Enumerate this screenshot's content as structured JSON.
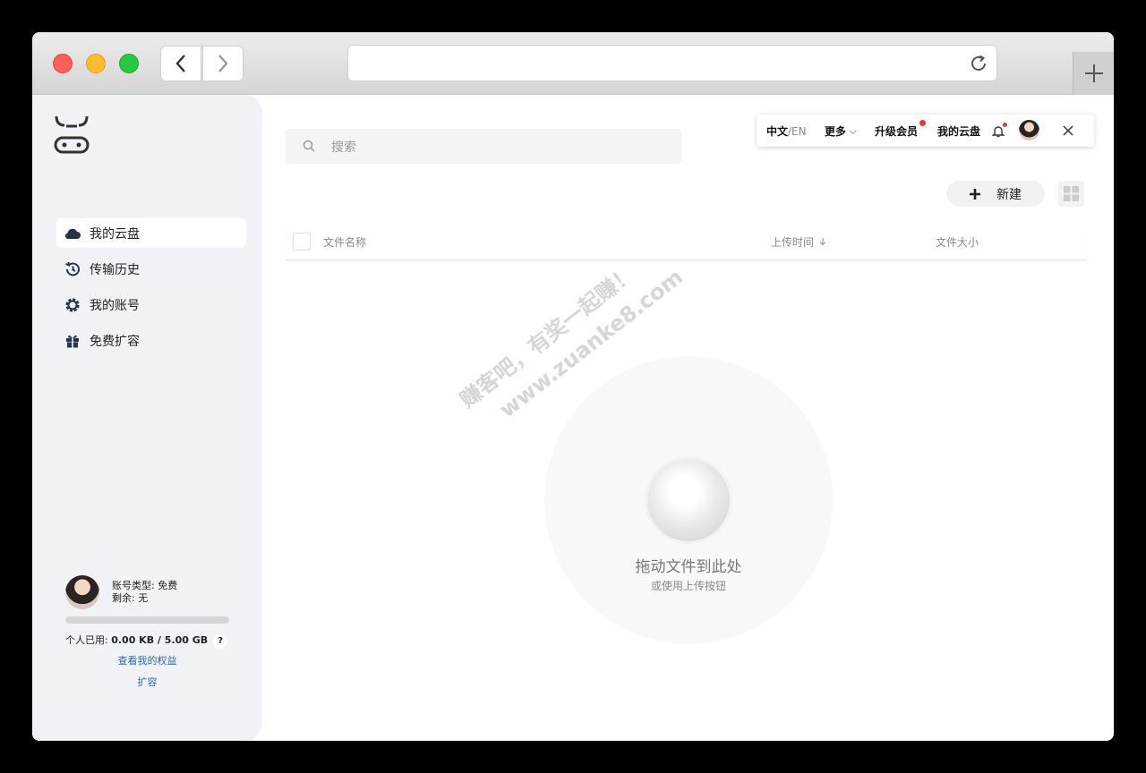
{
  "browser": {
    "url": ""
  },
  "sidebar": {
    "items": [
      {
        "label": "我的云盘",
        "icon": "cloud-icon",
        "active": true
      },
      {
        "label": "传输历史",
        "icon": "history-icon",
        "active": false
      },
      {
        "label": "我的账号",
        "icon": "gear-icon",
        "active": false
      },
      {
        "label": "免费扩容",
        "icon": "gift-icon",
        "active": false
      }
    ],
    "account": {
      "type_label": "账号类型: 免费",
      "remaining_label": "剩余: 无",
      "usage_prefix": "个人已用: ",
      "usage_value": "0.00 KB / 5.00 GB",
      "usage_fraction": 0,
      "help": "?",
      "benefits_link": "查看我的权益",
      "expand_link": "扩容"
    }
  },
  "search": {
    "placeholder": "搜索"
  },
  "topmenu": {
    "lang_zh": "中文",
    "lang_en": "/EN",
    "more": "更多",
    "upgrade": "升级会员",
    "my_drive": "我的云盘"
  },
  "toolbar": {
    "new_label": "新建"
  },
  "table": {
    "columns": {
      "name": "文件名称",
      "upload_time": "上传时间",
      "size": "文件大小"
    }
  },
  "dropzone": {
    "title": "拖动文件到此处",
    "subtitle": "或使用上传按钮"
  },
  "watermark": {
    "line1": "赚客吧，有奖一起赚！",
    "line2": "www.zuanke8.com"
  },
  "colors": {
    "accent": "#2f6aa8",
    "sidebar_bg": "#f0f2f6",
    "notice_dot": "#e53935"
  }
}
